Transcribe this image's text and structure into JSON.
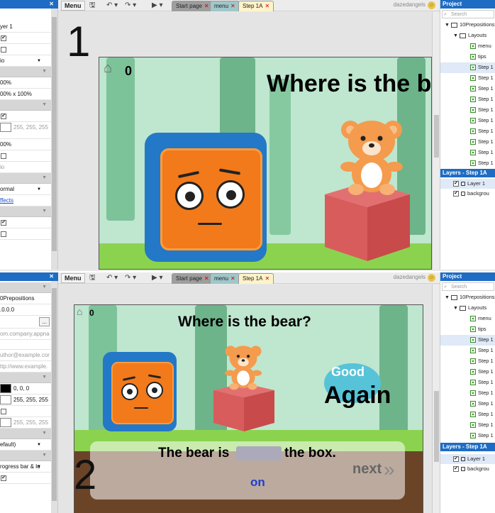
{
  "left_top": {
    "close_icon": "✕",
    "rows": [
      {
        "kind": "text",
        "text": "yer 1"
      },
      {
        "kind": "check",
        "checked": true
      },
      {
        "kind": "check",
        "checked": false
      },
      {
        "kind": "dropdown",
        "text": "io"
      },
      {
        "kind": "header"
      },
      {
        "kind": "text",
        "text": "00%"
      },
      {
        "kind": "text",
        "text": "00% x 100%"
      },
      {
        "kind": "header"
      },
      {
        "kind": "check",
        "checked": true
      },
      {
        "kind": "swatch",
        "text": "255, 255, 255",
        "muted": true,
        "tall": true
      },
      {
        "kind": "text",
        "text": "00%"
      },
      {
        "kind": "check",
        "checked": false
      },
      {
        "kind": "text",
        "text": "io",
        "muted": true
      },
      {
        "kind": "header"
      },
      {
        "kind": "dropdown",
        "text": "ormal"
      },
      {
        "kind": "link",
        "text": "ffects"
      },
      {
        "kind": "header"
      },
      {
        "kind": "check",
        "checked": true
      },
      {
        "kind": "check",
        "checked": false
      }
    ]
  },
  "left_bottom": {
    "close_icon": "✕",
    "rows": [
      {
        "kind": "header"
      },
      {
        "kind": "text",
        "text": "0Prepositions"
      },
      {
        "kind": "text",
        "text": ".0.0.0"
      },
      {
        "kind": "button",
        "text": "..."
      },
      {
        "kind": "text",
        "text": "om.company.appna",
        "muted": true
      },
      {
        "kind": "spacer"
      },
      {
        "kind": "text",
        "text": "uthor@example.cor",
        "muted": true
      },
      {
        "kind": "text",
        "text": "ttp://www.example.",
        "muted": true
      },
      {
        "kind": "header"
      },
      {
        "kind": "swatch",
        "text": "0, 0, 0",
        "black": true
      },
      {
        "kind": "swatch",
        "text": "255, 255, 255"
      },
      {
        "kind": "check",
        "checked": false
      },
      {
        "kind": "swatch",
        "text": "255, 255, 255",
        "muted": true
      },
      {
        "kind": "header"
      },
      {
        "kind": "dropdown",
        "text": "efault)"
      },
      {
        "kind": "header"
      },
      {
        "kind": "dropdown",
        "text": "rogress bar & lo"
      },
      {
        "kind": "check",
        "checked": true
      }
    ]
  },
  "toolbar": {
    "menu_label": "Menu",
    "tabs": [
      "Start page",
      "menu",
      "Step 1A"
    ],
    "tab_close": "✕",
    "user": "dazedangels"
  },
  "project": {
    "title": "Project",
    "search_placeholder": "Search",
    "root": "10Prepositions",
    "layouts_folder": "Layouts",
    "layouts": [
      "menu",
      "tips",
      "Step 1",
      "Step 1",
      "Step 1",
      "Step 1",
      "Step 1",
      "Step 1",
      "Step 1",
      "Step 1",
      "Step 1",
      "Step 1"
    ]
  },
  "layers": {
    "title": "Layers - Step 1A",
    "items": [
      "Layer 1",
      "backgrou"
    ]
  },
  "top_view": {
    "number": "1",
    "score": "0",
    "question": "Where is the be"
  },
  "bottom_view": {
    "number": "2",
    "score": "0",
    "question": "Where is the bear?",
    "try_word": "Good",
    "again": "Again",
    "sentence_before": "The bear is",
    "sentence_after": "the box.",
    "answer": "on",
    "next": "next"
  },
  "colors": {
    "accent": "#1e6cc4",
    "tab_active": "#fff3c9",
    "tab_start": "#9e9e9e",
    "tab_menu": "#9fc7c9",
    "character": "#f27a1a",
    "box": "#d95a5a",
    "grass": "#8bd34f",
    "answer": "#1a3fd0"
  }
}
